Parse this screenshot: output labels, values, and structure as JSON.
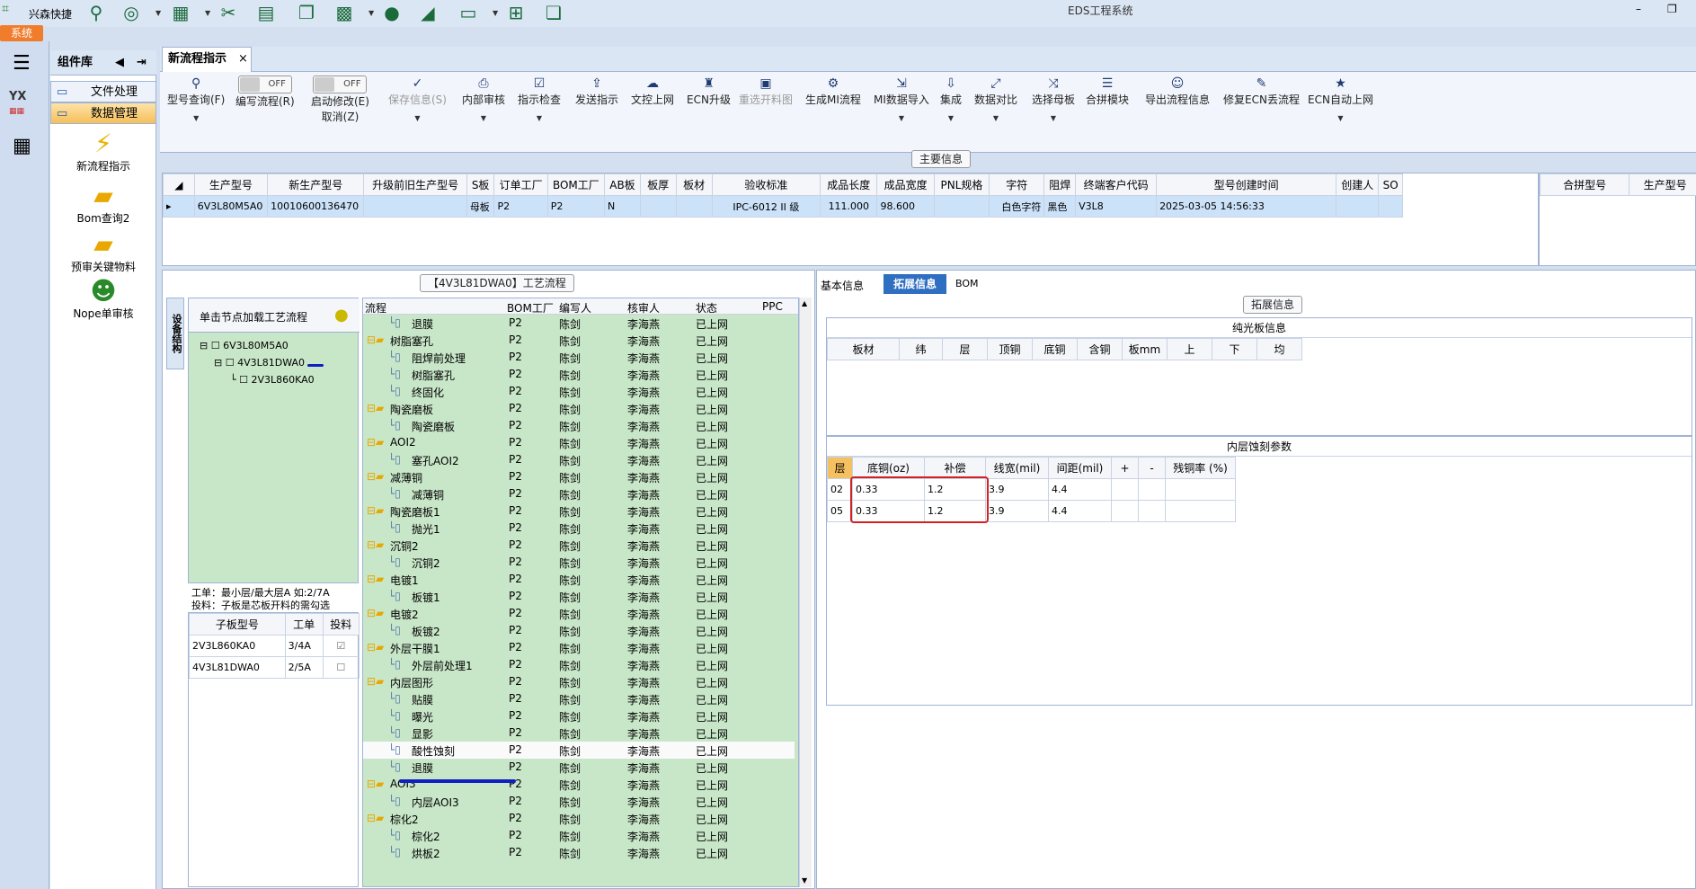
{
  "app": {
    "title": "EDS工程系统",
    "brand": "兴森快捷",
    "system_tab": "系统"
  },
  "complib": {
    "title": "组件库",
    "items": [
      {
        "label": "文件处理"
      },
      {
        "label": "数据管理"
      }
    ],
    "tools": [
      {
        "label": "新流程指示",
        "icon": "lightning-icon"
      },
      {
        "label": "Bom查询2",
        "icon": "folder-icon"
      },
      {
        "label": "预审关键物料",
        "icon": "folder-icon"
      },
      {
        "label": "Nope单审核",
        "icon": "user-icon"
      }
    ]
  },
  "doc_tab": {
    "label": "新流程指示",
    "close": "×"
  },
  "ribbon": [
    {
      "label": "型号查询(F)",
      "icon": "search-icon",
      "dd": true
    },
    {
      "label": "编写流程(R)",
      "toggle": "OFF"
    },
    {
      "label": "启动修改(E)",
      "label2": "取消(Z)",
      "toggle": "OFF"
    },
    {
      "label": "保存信息(S)",
      "icon": "check-icon",
      "dis": true,
      "dd": true
    },
    {
      "label": "内部审核",
      "icon": "print-icon",
      "dd": true
    },
    {
      "label": "指示检查",
      "icon": "checkbox-icon",
      "dd": true
    },
    {
      "label": "发送指示",
      "icon": "upload-icon"
    },
    {
      "label": "文控上网",
      "icon": "cloud-upload-icon"
    },
    {
      "label": "ECN升级",
      "icon": "ecn-icon"
    },
    {
      "label": "重选开料图",
      "icon": "image-icon",
      "dis": true
    },
    {
      "label": "生成MI流程",
      "icon": "gears-icon"
    },
    {
      "label": "MI数据导入",
      "icon": "import-icon",
      "dd": true
    },
    {
      "label": "集成",
      "icon": "download-icon",
      "dd": true
    },
    {
      "label": "数据对比",
      "icon": "compare-icon",
      "dd": true
    },
    {
      "label": "选择母板",
      "icon": "shuffle-icon",
      "dd": true
    },
    {
      "label": "合拼模块",
      "icon": "list-icon"
    },
    {
      "label": "导出流程信息",
      "icon": "smile-icon"
    },
    {
      "label": "修复ECN丢流程",
      "icon": "wrench-icon"
    },
    {
      "label": "ECN自动上网",
      "icon": "star-icon",
      "dd": true
    }
  ],
  "main_info": {
    "caption": "主要信息",
    "headers": [
      "生产型号",
      "新生产型号",
      "升级前旧生产型号",
      "S板",
      "订单工厂",
      "BOM工厂",
      "AB板",
      "板厚",
      "板材",
      "验收标准",
      "成品长度",
      "成品宽度",
      "PNL规格",
      "字符",
      "阻焊",
      "终端客户代码",
      "型号创建时间",
      "创建人",
      "SO"
    ],
    "row": [
      "6V3L80M5A0",
      "10010600136470",
      "",
      "母板",
      "P2",
      "P2",
      "N",
      "",
      "",
      "IPC-6012 II 级",
      "111.000",
      "98.600",
      "",
      "白色字符",
      "黑色",
      "V3L8",
      "2025-03-05 14:56:33",
      "",
      ""
    ],
    "right_headers": [
      "合拼型号",
      "生产型号"
    ]
  },
  "left_panel": {
    "vtab": "设备结构",
    "caption": "【4V3L81DWA0】工艺流程",
    "hint": "单击节点加载工艺流程",
    "tree": [
      "6V3L80M5A0",
      "4V3L81DWA0",
      "2V3L860KA0"
    ],
    "notes": [
      "工单：最小层/最大层A 如:2/7A",
      "投料：子板是芯板开料的需勾选"
    ],
    "sub_headers": [
      "子板型号",
      "工单",
      "投料"
    ],
    "sub_rows": [
      {
        "model": "2V3L860KA0",
        "order": "3/4A",
        "checked": true
      },
      {
        "model": "4V3L81DWA0",
        "order": "2/5A",
        "checked": false
      }
    ]
  },
  "process": {
    "headers": [
      "流程",
      "BOM工厂",
      "编写人",
      "核审人",
      "状态",
      "PPC"
    ],
    "rows": [
      {
        "name": "退膜",
        "lvl": 2,
        "f": "P2",
        "w": "陈剑",
        "r": "李海燕",
        "s": "已上网"
      },
      {
        "name": "树脂塞孔",
        "lvl": 1,
        "f": "P2",
        "w": "陈剑",
        "r": "李海燕",
        "s": "已上网"
      },
      {
        "name": "阻焊前处理",
        "lvl": 2,
        "f": "P2",
        "w": "陈剑",
        "r": "李海燕",
        "s": "已上网"
      },
      {
        "name": "树脂塞孔",
        "lvl": 2,
        "f": "P2",
        "w": "陈剑",
        "r": "李海燕",
        "s": "已上网"
      },
      {
        "name": "终固化",
        "lvl": 2,
        "f": "P2",
        "w": "陈剑",
        "r": "李海燕",
        "s": "已上网"
      },
      {
        "name": "陶瓷磨板",
        "lvl": 1,
        "f": "P2",
        "w": "陈剑",
        "r": "李海燕",
        "s": "已上网"
      },
      {
        "name": "陶瓷磨板",
        "lvl": 2,
        "f": "P2",
        "w": "陈剑",
        "r": "李海燕",
        "s": "已上网"
      },
      {
        "name": "AOI2",
        "lvl": 1,
        "f": "P2",
        "w": "陈剑",
        "r": "李海燕",
        "s": "已上网"
      },
      {
        "name": "塞孔AOI2",
        "lvl": 2,
        "f": "P2",
        "w": "陈剑",
        "r": "李海燕",
        "s": "已上网"
      },
      {
        "name": "减薄铜",
        "lvl": 1,
        "f": "P2",
        "w": "陈剑",
        "r": "李海燕",
        "s": "已上网"
      },
      {
        "name": "减薄铜",
        "lvl": 2,
        "f": "P2",
        "w": "陈剑",
        "r": "李海燕",
        "s": "已上网"
      },
      {
        "name": "陶瓷磨板1",
        "lvl": 1,
        "f": "P2",
        "w": "陈剑",
        "r": "李海燕",
        "s": "已上网"
      },
      {
        "name": "抛光1",
        "lvl": 2,
        "f": "P2",
        "w": "陈剑",
        "r": "李海燕",
        "s": "已上网"
      },
      {
        "name": "沉铜2",
        "lvl": 1,
        "f": "P2",
        "w": "陈剑",
        "r": "李海燕",
        "s": "已上网"
      },
      {
        "name": "沉铜2",
        "lvl": 2,
        "f": "P2",
        "w": "陈剑",
        "r": "李海燕",
        "s": "已上网"
      },
      {
        "name": "电镀1",
        "lvl": 1,
        "f": "P2",
        "w": "陈剑",
        "r": "李海燕",
        "s": "已上网"
      },
      {
        "name": "板镀1",
        "lvl": 2,
        "f": "P2",
        "w": "陈剑",
        "r": "李海燕",
        "s": "已上网"
      },
      {
        "name": "电镀2",
        "lvl": 1,
        "f": "P2",
        "w": "陈剑",
        "r": "李海燕",
        "s": "已上网"
      },
      {
        "name": "板镀2",
        "lvl": 2,
        "f": "P2",
        "w": "陈剑",
        "r": "李海燕",
        "s": "已上网"
      },
      {
        "name": "外层干膜1",
        "lvl": 1,
        "f": "P2",
        "w": "陈剑",
        "r": "李海燕",
        "s": "已上网"
      },
      {
        "name": "外层前处理1",
        "lvl": 2,
        "f": "P2",
        "w": "陈剑",
        "r": "李海燕",
        "s": "已上网"
      },
      {
        "name": "内层图形",
        "lvl": 1,
        "f": "P2",
        "w": "陈剑",
        "r": "李海燕",
        "s": "已上网"
      },
      {
        "name": "贴膜",
        "lvl": 2,
        "f": "P2",
        "w": "陈剑",
        "r": "李海燕",
        "s": "已上网"
      },
      {
        "name": "曝光",
        "lvl": 2,
        "f": "P2",
        "w": "陈剑",
        "r": "李海燕",
        "s": "已上网"
      },
      {
        "name": "显影",
        "lvl": 2,
        "f": "P2",
        "w": "陈剑",
        "r": "李海燕",
        "s": "已上网"
      },
      {
        "name": "酸性蚀刻",
        "lvl": 2,
        "f": "P2",
        "w": "陈剑",
        "r": "李海燕",
        "s": "已上网",
        "sel": true
      },
      {
        "name": "退膜",
        "lvl": 2,
        "f": "P2",
        "w": "陈剑",
        "r": "李海燕",
        "s": "已上网"
      },
      {
        "name": "AOI3",
        "lvl": 1,
        "f": "P2",
        "w": "陈剑",
        "r": "李海燕",
        "s": "已上网"
      },
      {
        "name": "内层AOI3",
        "lvl": 2,
        "f": "P2",
        "w": "陈剑",
        "r": "李海燕",
        "s": "已上网"
      },
      {
        "name": "棕化2",
        "lvl": 1,
        "f": "P2",
        "w": "陈剑",
        "r": "李海燕",
        "s": "已上网"
      },
      {
        "name": "棕化2",
        "lvl": 2,
        "f": "P2",
        "w": "陈剑",
        "r": "李海燕",
        "s": "已上网"
      },
      {
        "name": "烘板2",
        "lvl": 2,
        "f": "P2",
        "w": "陈剑",
        "r": "李海燕",
        "s": "已上网"
      }
    ]
  },
  "right_panel": {
    "tabs": [
      "基本信息",
      "拓展信息",
      "BOM"
    ],
    "caption": "拓展信息",
    "pure": {
      "title": "纯光板信息",
      "headers": [
        "板材",
        "纬",
        "层",
        "顶铜",
        "底铜",
        "含铜",
        "板mm",
        "上",
        "下",
        "均"
      ]
    },
    "inner": {
      "title": "内层蚀刻参数",
      "headers": [
        "层",
        "底铜(oz)",
        "补偿",
        "线宽(mil)",
        "间距(mil)",
        "+",
        "-",
        "残铜率 (%)"
      ],
      "rows": [
        [
          "02",
          "0.33",
          "1.2",
          "3.9",
          "4.4",
          "",
          "",
          ""
        ],
        [
          "05",
          "0.33",
          "1.2",
          "3.9",
          "4.4",
          "",
          "",
          ""
        ]
      ]
    }
  }
}
